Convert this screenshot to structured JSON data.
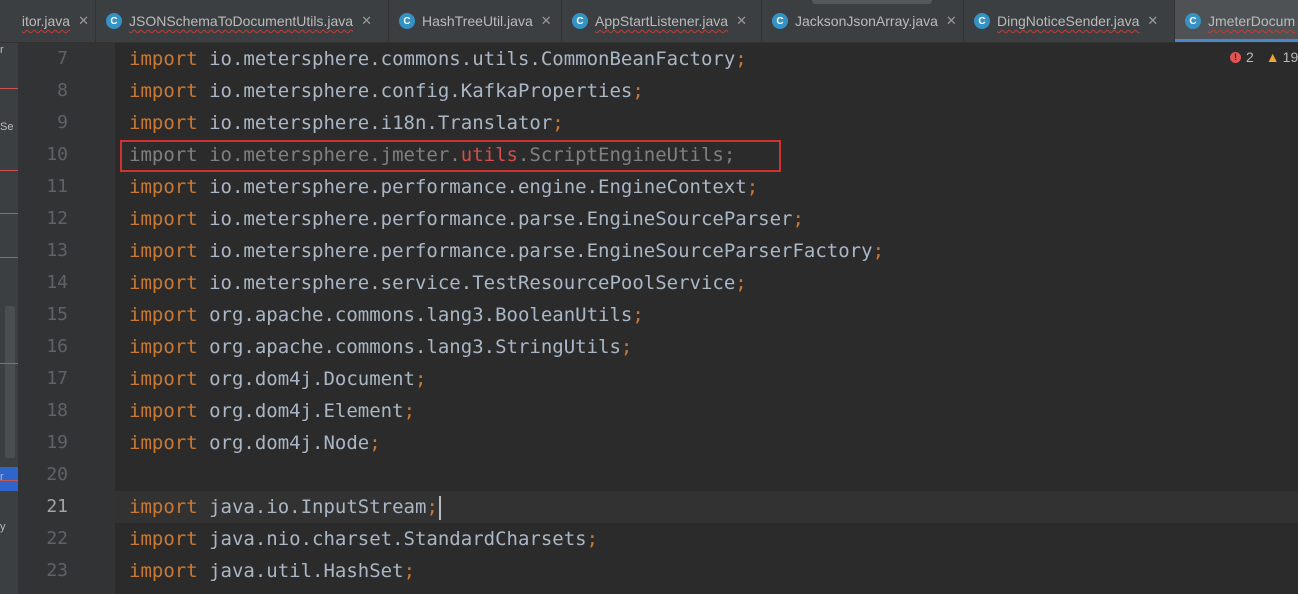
{
  "tabs": [
    {
      "label": "itor.java",
      "icon": "",
      "active": false,
      "error": true
    },
    {
      "label": "JSONSchemaToDocumentUtils.java",
      "icon": "C",
      "active": false,
      "error": true
    },
    {
      "label": "HashTreeUtil.java",
      "icon": "C",
      "active": false,
      "error": false
    },
    {
      "label": "AppStartListener.java",
      "icon": "C",
      "active": false,
      "error": true
    },
    {
      "label": "JacksonJsonArray.java",
      "icon": "C",
      "active": false,
      "error": false
    },
    {
      "label": "DingNoticeSender.java",
      "icon": "C",
      "active": false,
      "error": true
    },
    {
      "label": "JmeterDocum",
      "icon": "C",
      "active": true,
      "error": true
    }
  ],
  "tab_close_glyph": "✕",
  "inspection": {
    "errors": "2",
    "warnings": "19"
  },
  "left_strip": {
    "labels": [
      "r",
      "Se",
      "r",
      "y"
    ]
  },
  "gutter": {
    "lines": [
      "7",
      "8",
      "9",
      "10",
      "11",
      "12",
      "13",
      "14",
      "15",
      "16",
      "17",
      "18",
      "19",
      "20",
      "21",
      "22",
      "23"
    ],
    "current_line": "21"
  },
  "code": {
    "keyword": "import",
    "lines": [
      {
        "path": "io.metersphere.commons.utils.CommonBeanFactory",
        "semi": ";"
      },
      {
        "path": "io.metersphere.config.KafkaProperties",
        "semi": ";"
      },
      {
        "path": "io.metersphere.i18n.Translator",
        "semi": ";"
      },
      {
        "pre": "io.metersphere.jmeter.",
        "errpart": "utils",
        "post": ".ScriptEngineUtils",
        "semi": ";",
        "unused": true
      },
      {
        "path": "io.metersphere.performance.engine.EngineContext",
        "semi": ";"
      },
      {
        "path": "io.metersphere.performance.parse.EngineSourceParser",
        "semi": ";"
      },
      {
        "path": "io.metersphere.performance.parse.EngineSourceParserFactory",
        "semi": ";"
      },
      {
        "path": "io.metersphere.service.TestResourcePoolService",
        "semi": ";"
      },
      {
        "path": "org.apache.commons.lang3.BooleanUtils",
        "semi": ";"
      },
      {
        "path": "org.apache.commons.lang3.StringUtils",
        "semi": ";"
      },
      {
        "path": "org.dom4j.Document",
        "semi": ";"
      },
      {
        "path": "org.dom4j.Element",
        "semi": ";"
      },
      {
        "path": "org.dom4j.Node",
        "semi": ";"
      },
      {
        "blank": true
      },
      {
        "path": "java.io.InputStream",
        "semi": ";",
        "caret": true
      },
      {
        "path": "java.nio.charset.StandardCharsets",
        "semi": ";"
      },
      {
        "path": "java.util.HashSet",
        "semi": ";"
      }
    ]
  },
  "colors": {
    "keyword": "#cc7832",
    "text": "#a9b7c6",
    "unused": "#808080",
    "error": "#d64d4d",
    "highlight_box": "#d03232"
  }
}
